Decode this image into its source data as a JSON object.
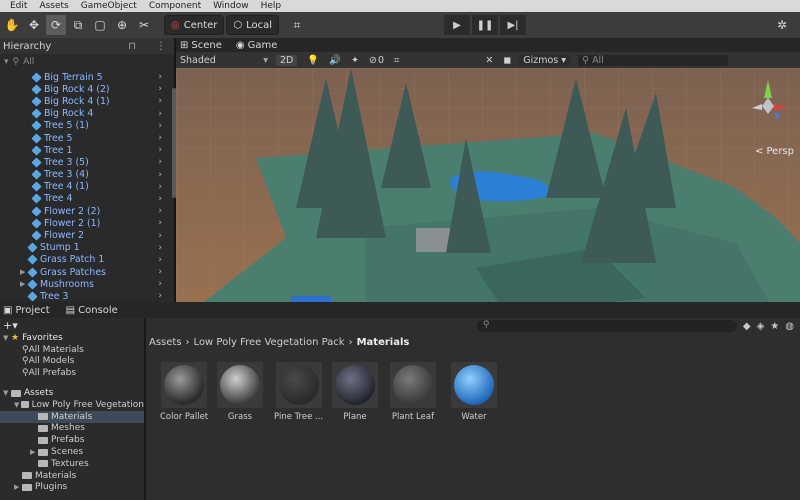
{
  "menu": [
    "Edit",
    "Assets",
    "GameObject",
    "Component",
    "Window",
    "Help"
  ],
  "toolbar": {
    "pivot_label": "Center",
    "space_label": "Local"
  },
  "hierarchy": {
    "tab_label": "Hierarchy",
    "search_placeholder": "All",
    "items": [
      {
        "label": "Big Terrain 5"
      },
      {
        "label": "Big Rock 4 (2)"
      },
      {
        "label": "Big Rock 4 (1)"
      },
      {
        "label": "Big Rock 4"
      },
      {
        "label": "Tree 5 (1)"
      },
      {
        "label": "Tree 5"
      },
      {
        "label": "Tree 1"
      },
      {
        "label": "Tree 3 (5)"
      },
      {
        "label": "Tree 3 (4)"
      },
      {
        "label": "Tree 4 (1)"
      },
      {
        "label": "Tree 4"
      },
      {
        "label": "Flower 2 (2)"
      },
      {
        "label": "Flower 2 (1)"
      },
      {
        "label": "Flower 2"
      },
      {
        "label": "Stump 1"
      },
      {
        "label": "Grass Patch 1"
      },
      {
        "label": "Grass Patches"
      },
      {
        "label": "Mushrooms"
      },
      {
        "label": "Tree 3"
      }
    ]
  },
  "scene": {
    "tab_scene": "Scene",
    "tab_game": "Game",
    "shading": "Shaded",
    "mode_2d": "2D",
    "hidden_count": "0",
    "gizmos": "Gizmos",
    "search_placeholder": "All",
    "persp_label": "< Persp"
  },
  "project": {
    "tab_project": "Project",
    "tab_console": "Console",
    "favorites": {
      "label": "Favorites",
      "items": [
        "All Materials",
        "All Models",
        "All Prefabs"
      ]
    },
    "assets_label": "Assets",
    "tree": [
      {
        "label": "Low Poly Free Vegetation",
        "depth": 1,
        "selected": false
      },
      {
        "label": "Materials",
        "depth": 2,
        "selected": true
      },
      {
        "label": "Meshes",
        "depth": 2,
        "selected": false
      },
      {
        "label": "Prefabs",
        "depth": 2,
        "selected": false
      },
      {
        "label": "Scenes",
        "depth": 2,
        "selected": false
      },
      {
        "label": "Textures",
        "depth": 2,
        "selected": false
      },
      {
        "label": "Materials",
        "depth": 1,
        "selected": false
      },
      {
        "label": "Plugins",
        "depth": 1,
        "selected": false
      }
    ],
    "breadcrumb": [
      "Assets",
      "Low Poly Free Vegetation Pack",
      "Materials"
    ],
    "materials": [
      {
        "label": "Color Pallet",
        "icon": "textured-sphere"
      },
      {
        "label": "Grass",
        "icon": "grass-sphere"
      },
      {
        "label": "Pine Tree ...",
        "icon": "pine-sphere"
      },
      {
        "label": "Plane",
        "icon": "dark-sphere"
      },
      {
        "label": "Plant Leaf",
        "icon": "light-sphere"
      },
      {
        "label": "Water",
        "icon": "blue-sphere"
      }
    ]
  },
  "colors": {
    "accent_blue": "#58a8e8",
    "sky": "#8a6b4e",
    "ground": "#4a7f70"
  }
}
